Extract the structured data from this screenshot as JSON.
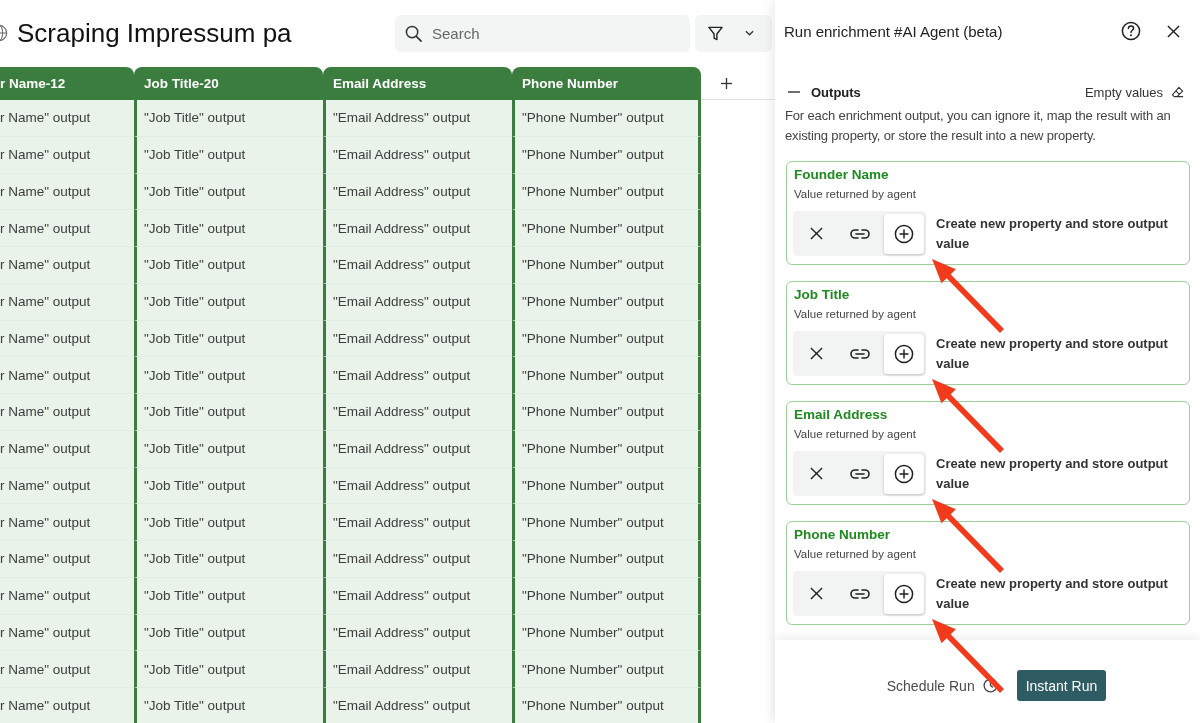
{
  "header": {
    "title": "Scraping Impressum pa",
    "search": {
      "placeholder": "Search"
    }
  },
  "table": {
    "columns": [
      "r Name-12",
      "Job Title-20",
      "Email Address",
      "Phone Number"
    ],
    "rows": [
      [
        "r Name\" output",
        "\"Job Title\" output",
        "\"Email Address\" output",
        "\"Phone Number\" output"
      ],
      [
        "r Name\" output",
        "\"Job Title\" output",
        "\"Email Address\" output",
        "\"Phone Number\" output"
      ],
      [
        "r Name\" output",
        "\"Job Title\" output",
        "\"Email Address\" output",
        "\"Phone Number\" output"
      ],
      [
        "r Name\" output",
        "\"Job Title\" output",
        "\"Email Address\" output",
        "\"Phone Number\" output"
      ],
      [
        "r Name\" output",
        "\"Job Title\" output",
        "\"Email Address\" output",
        "\"Phone Number\" output"
      ],
      [
        "r Name\" output",
        "\"Job Title\" output",
        "\"Email Address\" output",
        "\"Phone Number\" output"
      ],
      [
        "r Name\" output",
        "\"Job Title\" output",
        "\"Email Address\" output",
        "\"Phone Number\" output"
      ],
      [
        "r Name\" output",
        "\"Job Title\" output",
        "\"Email Address\" output",
        "\"Phone Number\" output"
      ],
      [
        "r Name\" output",
        "\"Job Title\" output",
        "\"Email Address\" output",
        "\"Phone Number\" output"
      ],
      [
        "r Name\" output",
        "\"Job Title\" output",
        "\"Email Address\" output",
        "\"Phone Number\" output"
      ],
      [
        "r Name\" output",
        "\"Job Title\" output",
        "\"Email Address\" output",
        "\"Phone Number\" output"
      ],
      [
        "r Name\" output",
        "\"Job Title\" output",
        "\"Email Address\" output",
        "\"Phone Number\" output"
      ],
      [
        "r Name\" output",
        "\"Job Title\" output",
        "\"Email Address\" output",
        "\"Phone Number\" output"
      ],
      [
        "r Name\" output",
        "\"Job Title\" output",
        "\"Email Address\" output",
        "\"Phone Number\" output"
      ],
      [
        "r Name\" output",
        "\"Job Title\" output",
        "\"Email Address\" output",
        "\"Phone Number\" output"
      ],
      [
        "r Name\" output",
        "\"Job Title\" output",
        "\"Email Address\" output",
        "\"Phone Number\" output"
      ],
      [
        "r Name\" output",
        "\"Job Title\" output",
        "\"Email Address\" output",
        "\"Phone Number\" output"
      ]
    ]
  },
  "panel": {
    "title": "Run enrichment #AI Agent (beta)",
    "section": {
      "title": "Outputs",
      "expanded": true,
      "action": "Empty values",
      "description": "For each enrichment output, you can ignore it, map the result with an existing property, or store the result into a new property."
    },
    "outputs": [
      {
        "name": "Founder Name",
        "subtitle": "Value returned by agent",
        "modes": [
          {
            "kind": "ignore",
            "selected": false
          },
          {
            "kind": "map",
            "selected": false
          },
          {
            "kind": "create",
            "selected": true
          }
        ],
        "mode_label": "Create new property and store output value"
      },
      {
        "name": "Job Title",
        "subtitle": "Value returned by agent",
        "modes": [
          {
            "kind": "ignore",
            "selected": false
          },
          {
            "kind": "map",
            "selected": false
          },
          {
            "kind": "create",
            "selected": true
          }
        ],
        "mode_label": "Create new property and store output value"
      },
      {
        "name": "Email Address",
        "subtitle": "Value returned by agent",
        "modes": [
          {
            "kind": "ignore",
            "selected": false
          },
          {
            "kind": "map",
            "selected": false
          },
          {
            "kind": "create",
            "selected": true
          }
        ],
        "mode_label": "Create new property and store output value"
      },
      {
        "name": "Phone Number",
        "subtitle": "Value returned by agent",
        "modes": [
          {
            "kind": "ignore",
            "selected": false
          },
          {
            "kind": "map",
            "selected": false
          },
          {
            "kind": "create",
            "selected": true
          }
        ],
        "mode_label": "Create new property and store output value"
      }
    ],
    "footer": {
      "schedule": "Schedule Run",
      "run": "Instant Run"
    }
  }
}
